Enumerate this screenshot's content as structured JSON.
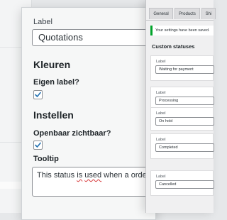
{
  "edit_form": {
    "label_field_label": "Label",
    "label_value": "Quotations",
    "colors_heading": "Kleuren",
    "custom_label_question": "Eigen label?",
    "custom_label_checked": true,
    "settings_heading": "Instellen",
    "public_question": "Openbaar zichtbaar?",
    "public_checked": true,
    "tooltip_label": "Tooltip",
    "tooltip_prefix": "This status ",
    "tooltip_misspelled_1": "is",
    "tooltip_space": " ",
    "tooltip_misspelled_2": "used",
    "tooltip_suffix": " when a orde"
  },
  "settings": {
    "tabs": [
      "General",
      "Products",
      "Shi"
    ],
    "notice": "Your settings have been saved.",
    "section_title": "Custom statuses",
    "statuses": [
      {
        "label": "Label",
        "value": "Waiting for payment"
      },
      {
        "label": "Label",
        "value": "Processing"
      },
      {
        "label": "Label",
        "value": "On hold"
      },
      {
        "label": "Label",
        "value": "Completed"
      },
      {
        "label": "Label",
        "value": "Cancelled"
      }
    ]
  },
  "colors": {
    "checkbox_accent": "#2271b1",
    "notice_border": "#00a32a",
    "spellcheck": "#d63638"
  }
}
